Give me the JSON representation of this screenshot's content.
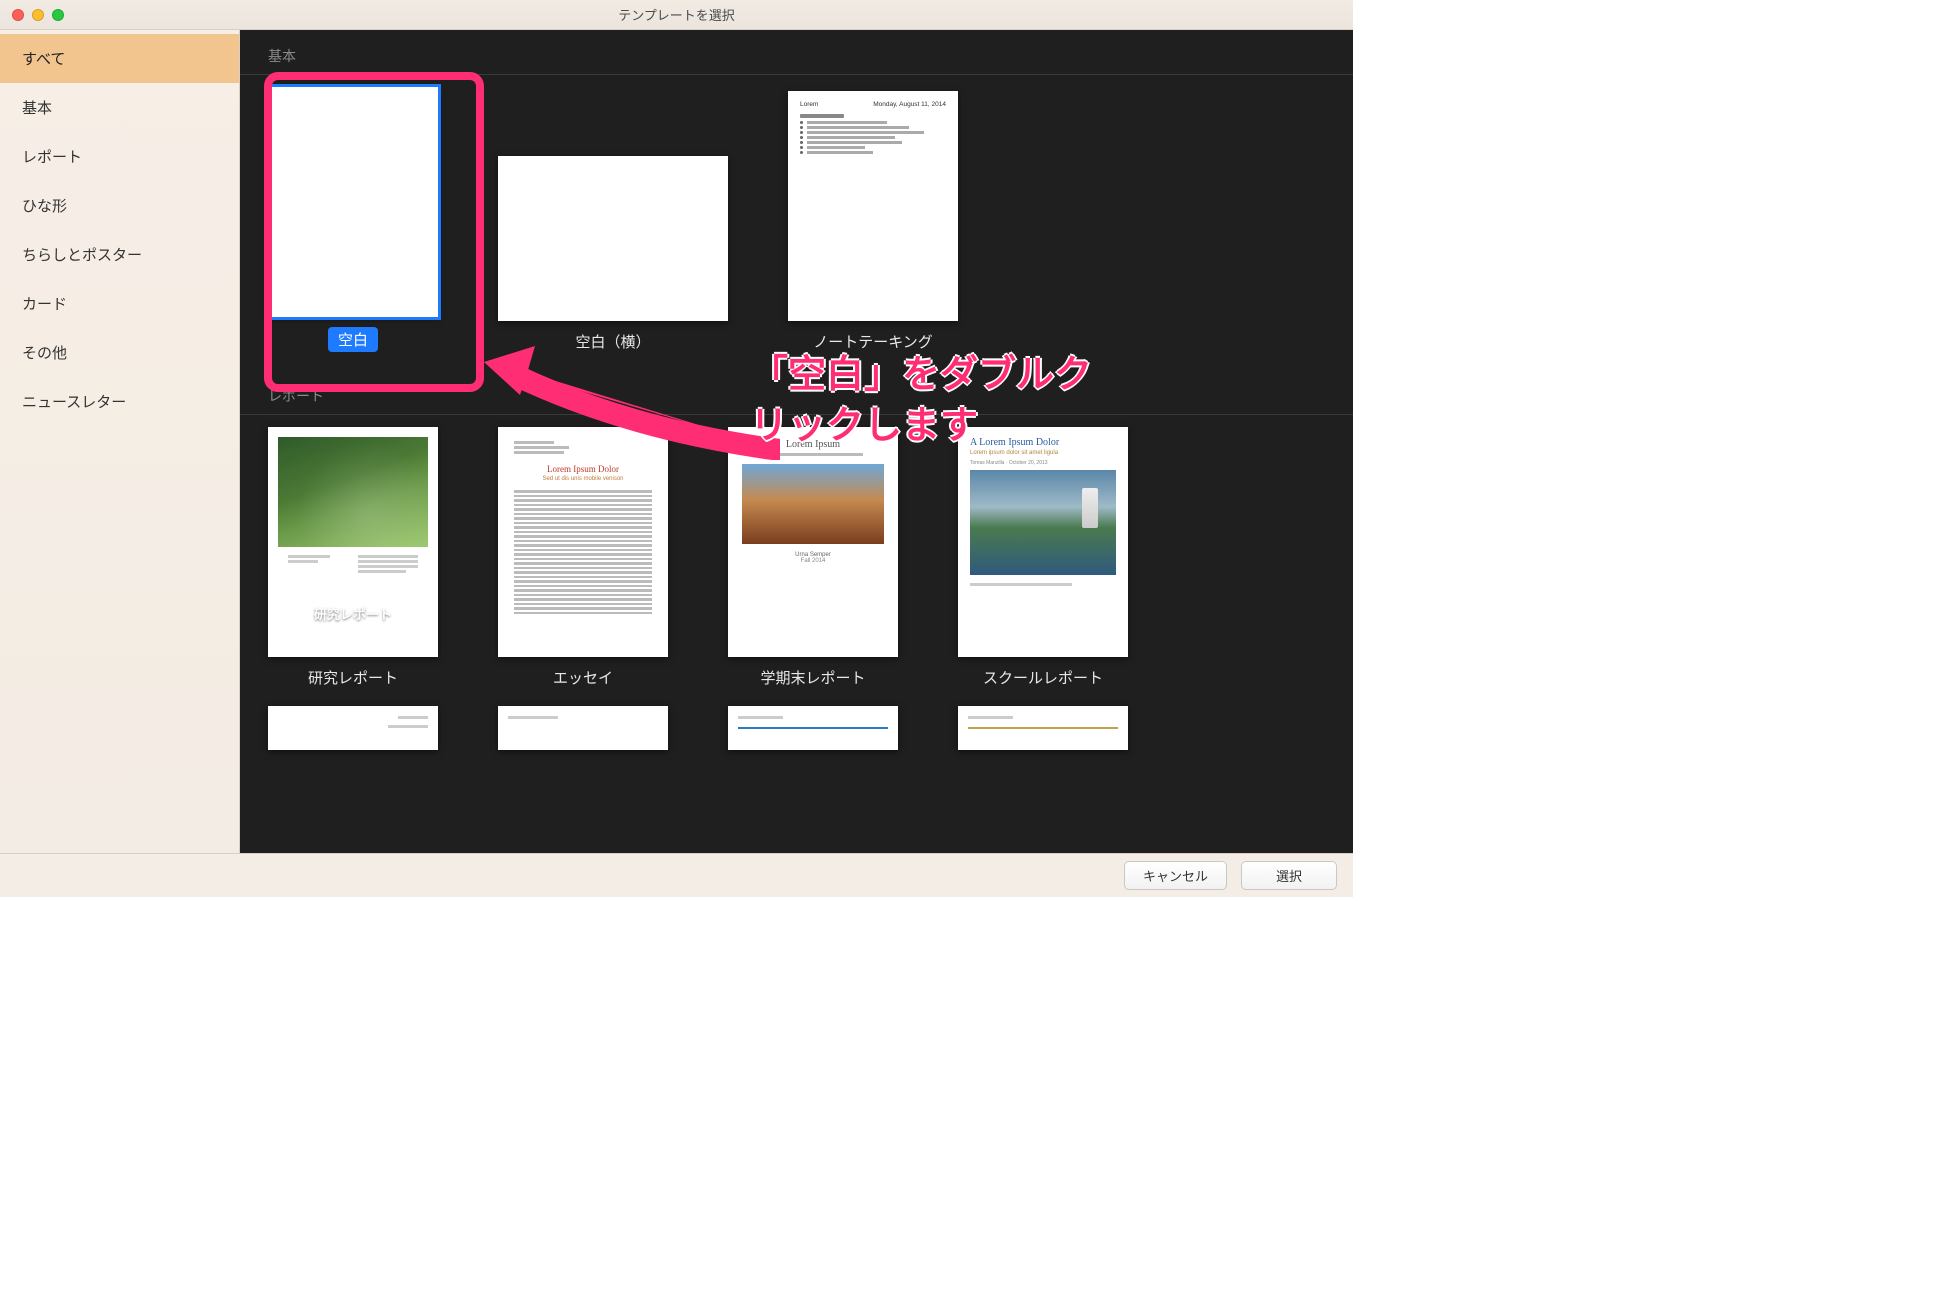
{
  "window": {
    "title": "テンプレートを選択"
  },
  "sidebar": {
    "items": [
      {
        "label": "すべて",
        "active": true
      },
      {
        "label": "基本"
      },
      {
        "label": "レポート"
      },
      {
        "label": "ひな形"
      },
      {
        "label": "ちらしとポスター"
      },
      {
        "label": "カード"
      },
      {
        "label": "その他"
      },
      {
        "label": "ニュースレター"
      }
    ]
  },
  "sections": {
    "basic": {
      "title": "基本",
      "templates": [
        {
          "label": "空白",
          "selected": true
        },
        {
          "label": "空白（横）"
        },
        {
          "label": "ノートテーキング"
        }
      ],
      "note_thumb": {
        "heading": "Lorem",
        "date": "Monday, August 11, 2014"
      }
    },
    "report": {
      "title": "レポート",
      "templates": [
        {
          "label": "研究レポート"
        },
        {
          "label": "エッセイ"
        },
        {
          "label": "学期末レポート"
        },
        {
          "label": "スクールレポート"
        }
      ],
      "research_overlay": "研究レポート",
      "essay_title": "Lorem Ipsum Dolor",
      "essay_sub": "Sed ut dis unis mobile venison",
      "term_title": "Lorem Ipsum",
      "term_caption1": "Urna Semper",
      "term_caption2": "Fall 2014",
      "school_title": "A Lorem Ipsum Dolor",
      "school_sub": "Lorem ipsum dolor sit amet ligula",
      "school_meta": "Tomas Manzilla · October 20, 2013"
    }
  },
  "annotation": {
    "text_line1": "「空白」をダブルク",
    "text_line2": "リックします"
  },
  "footer": {
    "cancel": "キャンセル",
    "choose": "選択"
  },
  "colors": {
    "accent": "#1e7bff",
    "annotation": "#ff2e74",
    "sidebar_active": "#f2c48e"
  }
}
